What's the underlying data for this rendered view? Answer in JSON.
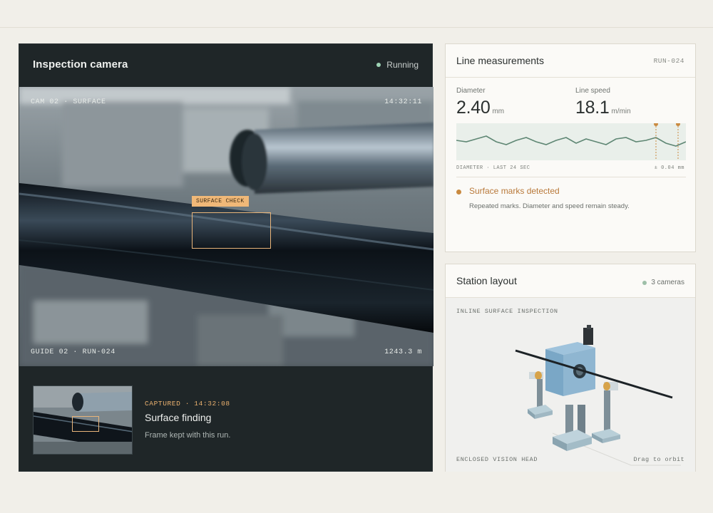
{
  "camera": {
    "title": "Inspection camera",
    "status": "Running",
    "overlay": {
      "top_left": "CAM 02 · SURFACE",
      "top_right": "14:32:11",
      "bottom_left": "GUIDE 02 · RUN-024",
      "bottom_right": "1243.3 m",
      "roi_label": "SURFACE CHECK"
    },
    "capture": {
      "meta": "CAPTURED · 14:32:08",
      "title": "Surface finding",
      "desc": "Frame kept with this run."
    }
  },
  "measurements": {
    "title": "Line measurements",
    "run_id": "RUN-024",
    "diameter": {
      "label": "Diameter",
      "value": "2.40",
      "unit": "mm"
    },
    "speed": {
      "label": "Line speed",
      "value": "18.1",
      "unit": "m/min"
    },
    "sparkline_caption": "DIAMETER · LAST 24 SEC",
    "sparkline_tolerance": "± 0.04 mm",
    "alert_title": "Surface marks detected",
    "alert_desc": "Repeated marks. Diameter and speed remain steady."
  },
  "station": {
    "title": "Station layout",
    "cameras": "3 cameras",
    "caption": "INLINE SURFACE INSPECTION",
    "footer_left": "ENCLOSED VISION HEAD",
    "footer_right": "Drag to orbit"
  },
  "colors": {
    "accent": "#e9b57a",
    "status_green": "#9dd3b4",
    "alert": "#c98a40",
    "panel_dark": "#1f2628"
  }
}
